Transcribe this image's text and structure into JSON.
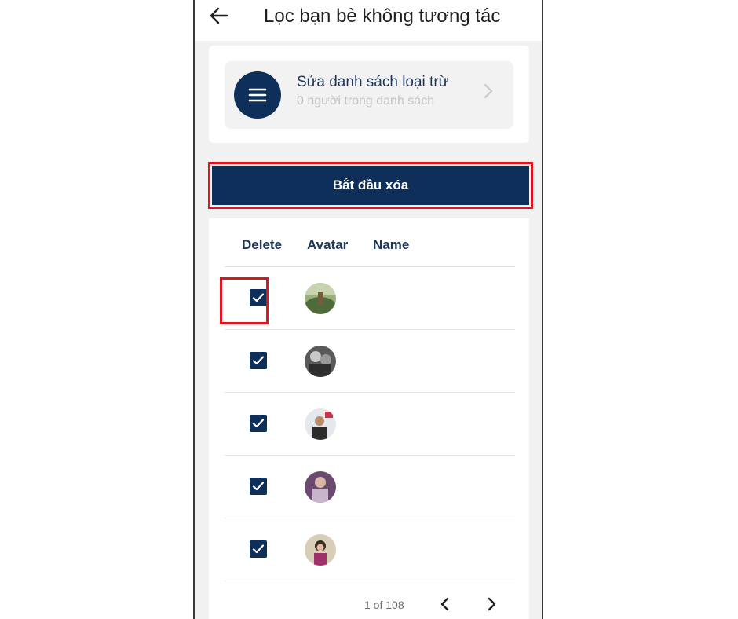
{
  "header": {
    "title": "Lọc bạn bè không tương tác",
    "back_icon": "arrow-left-icon"
  },
  "exclusion": {
    "title": "Sửa danh sách loại trừ",
    "subtitle": "0 người trong danh sách",
    "icon": "menu-icon",
    "chevron_icon": "chevron-right-icon"
  },
  "actions": {
    "start_delete_label": "Bắt đầu xóa"
  },
  "table": {
    "columns": [
      "Delete",
      "Avatar",
      "Name"
    ],
    "rows": [
      {
        "checked": true,
        "name": "",
        "avatar_colors": [
          "#7f9b5e",
          "#4f6b3c"
        ]
      },
      {
        "checked": true,
        "name": "",
        "avatar_colors": [
          "#8a8a8a",
          "#2e2e2e"
        ]
      },
      {
        "checked": true,
        "name": "",
        "avatar_colors": [
          "#d9dde3",
          "#2b2b2b"
        ]
      },
      {
        "checked": true,
        "name": "",
        "avatar_colors": [
          "#6a4a6e",
          "#c7b6c9"
        ]
      },
      {
        "checked": true,
        "name": "",
        "avatar_colors": [
          "#cbbfa8",
          "#a0306a"
        ]
      }
    ]
  },
  "pagination": {
    "text": "1 of 108",
    "prev_icon": "chevron-left-icon",
    "next_icon": "chevron-right-icon"
  },
  "colors": {
    "primary": "#0d2f59",
    "highlight": "#e0151e",
    "background": "#f1f1f1"
  }
}
